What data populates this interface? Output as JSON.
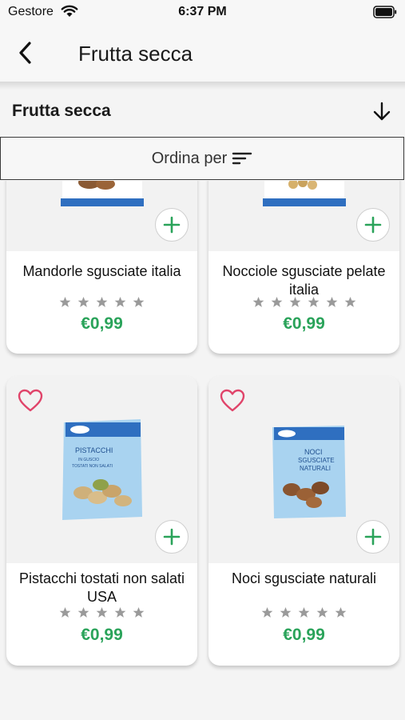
{
  "status_bar": {
    "carrier": "Gestore",
    "time": "6:37 PM"
  },
  "header": {
    "title": "Frutta secca",
    "back_icon": "chevron-left-icon"
  },
  "category": {
    "label": "Frutta secca",
    "icon": "arrow-down-icon"
  },
  "sort": {
    "label": "Ordina per",
    "icon": "sort-lines-icon"
  },
  "colors": {
    "price": "#2aa35a",
    "heart": "#e0446a",
    "add": "#2aa35a",
    "pack_blue": "#2f6fc0"
  },
  "products": [
    {
      "name": "Mandorle sgusciate italia",
      "price": "€0,99",
      "rating": 0
    },
    {
      "name": "Nocciole sgusciate pelate italia",
      "price": "€0,99",
      "rating": 0
    },
    {
      "name": "Pistacchi tostati non salati USA",
      "price": "€0,99",
      "rating": 0
    },
    {
      "name": "Noci sgusciate naturali",
      "price": "€0,99",
      "rating": 0
    }
  ],
  "pack_labels": {
    "pistacchi": [
      "PISTACCHI",
      "IN GUSCIO",
      "TOSTATI NON SALATI"
    ],
    "noci": [
      "NOCI",
      "SGUSCIATE",
      "NATURALI"
    ]
  }
}
